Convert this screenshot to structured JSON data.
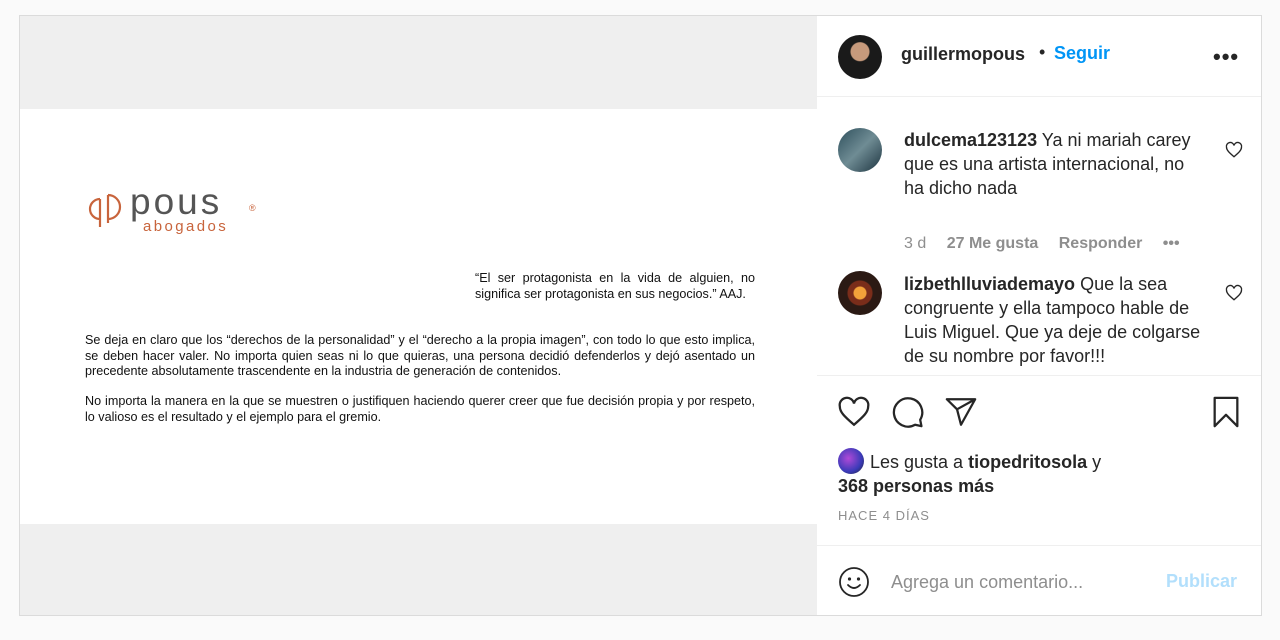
{
  "post": {
    "image": {
      "logo": {
        "word": "pous",
        "registered": "®",
        "sub": "abogados"
      },
      "quote": "“El ser protagonista en la vida de alguien, no significa ser protagonista en sus negocios.” AAJ.",
      "paragraph1": "Se deja en claro que los “derechos de la personalidad” y el “derecho a la propia imagen”, con todo lo que esto implica, se deben hacer valer. No importa quien seas ni lo que quieras, una persona decidió defenderlos y dejó asentado un precedente absolutamente trascendente en la industria de generación de contenidos.",
      "paragraph2": "No importa la manera en la que se muestren o justifiquen haciendo querer creer que fue decisión propia y por respeto, lo valioso es el resultado y el ejemplo para el gremio."
    },
    "header": {
      "username": "guillermopous",
      "separator": "•",
      "follow_label": "Seguir",
      "more_icon": "more-options-icon",
      "more_glyph": "•••"
    },
    "comments": [
      {
        "username": "dulcema123123",
        "text": "Ya ni mariah carey que es una artista internacional, no ha dicho nada",
        "time": "3 d",
        "likes": "27 Me gusta",
        "reply_label": "Responder",
        "more_glyph": "•••"
      },
      {
        "username": "lizbethlluviademayo",
        "text": "Que la sea congruente y ella tampoco hable de Luis Miguel. Que ya deje de colgarse de su nombre por favor!!!"
      }
    ],
    "likes": {
      "prefix": "Les gusta a",
      "user": "tiopedritosola",
      "conj": "y",
      "others": "368 personas más"
    },
    "time_ago": "HACE 4 DÍAS",
    "add_comment": {
      "placeholder": "Agrega un comentario...",
      "publish_label": "Publicar"
    },
    "colors": {
      "accent": "#0095f6",
      "publish_disabled": "#b2dffc",
      "logo_orange": "#c8643c",
      "muted": "#8e8e8e"
    }
  }
}
